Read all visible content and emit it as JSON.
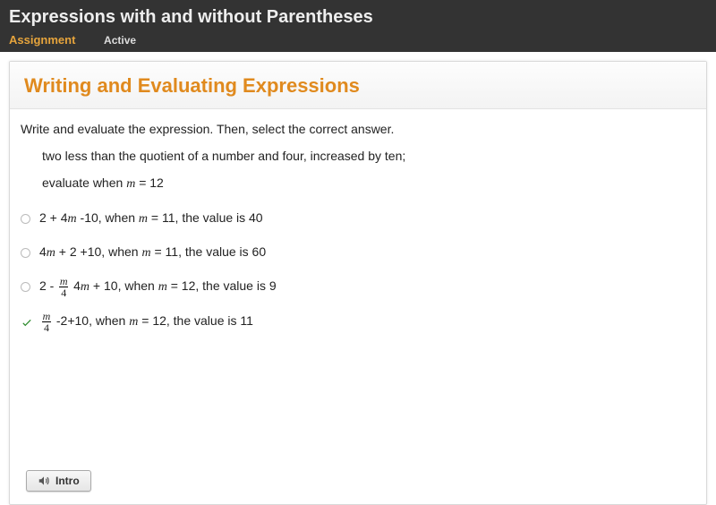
{
  "header": {
    "title": "Expressions with and without Parentheses",
    "assignment_label": "Assignment",
    "active_label": "Active"
  },
  "card": {
    "title": "Writing and Evaluating Expressions",
    "instruction": "Write and evaluate the expression. Then, select the correct answer.",
    "problem_line1": "two less than the quotient of a number and four, increased by ten;",
    "problem_line2_prefix": "evaluate when ",
    "problem_line2_var": "m",
    "problem_line2_suffix": " = 12"
  },
  "options": [
    {
      "selected": false,
      "checkmark": false,
      "parts": [
        {
          "t": "text",
          "v": "2 + 4"
        },
        {
          "t": "var",
          "v": "m"
        },
        {
          "t": "text",
          "v": " -10, when "
        },
        {
          "t": "var",
          "v": "m"
        },
        {
          "t": "text",
          "v": " = 11, the value is 40"
        }
      ]
    },
    {
      "selected": false,
      "checkmark": false,
      "parts": [
        {
          "t": "text",
          "v": "4"
        },
        {
          "t": "var",
          "v": "m"
        },
        {
          "t": "text",
          "v": " + 2 +10, when "
        },
        {
          "t": "var",
          "v": "m"
        },
        {
          "t": "text",
          "v": " = 11, the value is 60"
        }
      ]
    },
    {
      "selected": false,
      "checkmark": false,
      "parts": [
        {
          "t": "text",
          "v": "2 - "
        },
        {
          "t": "frac",
          "num": "m",
          "den": "4"
        },
        {
          "t": "text",
          "v": " 4"
        },
        {
          "t": "var",
          "v": "m"
        },
        {
          "t": "text",
          "v": " + 10, when "
        },
        {
          "t": "var",
          "v": "m"
        },
        {
          "t": "text",
          "v": " = 12, the value is 9"
        }
      ]
    },
    {
      "selected": true,
      "checkmark": true,
      "parts": [
        {
          "t": "frac",
          "num": "m",
          "den": "4"
        },
        {
          "t": "text",
          "v": " -2+10, when "
        },
        {
          "t": "var",
          "v": "m"
        },
        {
          "t": "text",
          "v": " = 12, the value is 11"
        }
      ]
    }
  ],
  "footer": {
    "intro_label": "Intro"
  },
  "colors": {
    "accent": "#e08a1e",
    "check": "#2a8a2a"
  }
}
